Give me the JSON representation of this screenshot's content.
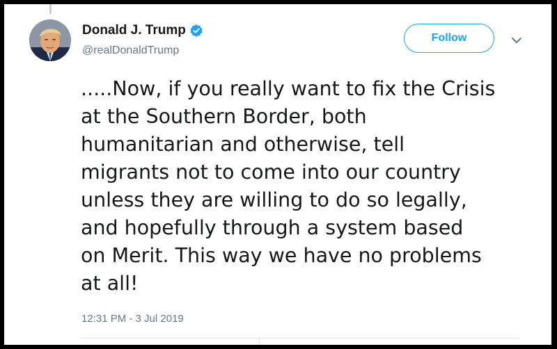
{
  "author": {
    "display_name": "Donald J. Trump",
    "handle": "@realDonaldTrump",
    "verified": true
  },
  "follow_button": {
    "label": "Follow"
  },
  "tweet": {
    "lines": [
      ".....Now, if you really want to fix the Crisis",
      "at the Southern Border, both",
      "humanitarian and otherwise, tell",
      "migrants not to come into our country",
      "unless they are willing to do so legally,",
      "and hopefully through a system based",
      "on Merit. This way we have no problems",
      "at all!"
    ],
    "timestamp": "12:31 PM - 3 Jul 2019"
  },
  "icons": {
    "verified": "verified-badge-icon",
    "menu": "chevron-down-icon"
  },
  "colors": {
    "accent": "#1da1f2",
    "text": "#14171a",
    "secondary_text": "#657786",
    "border": "#e1e8ed"
  }
}
